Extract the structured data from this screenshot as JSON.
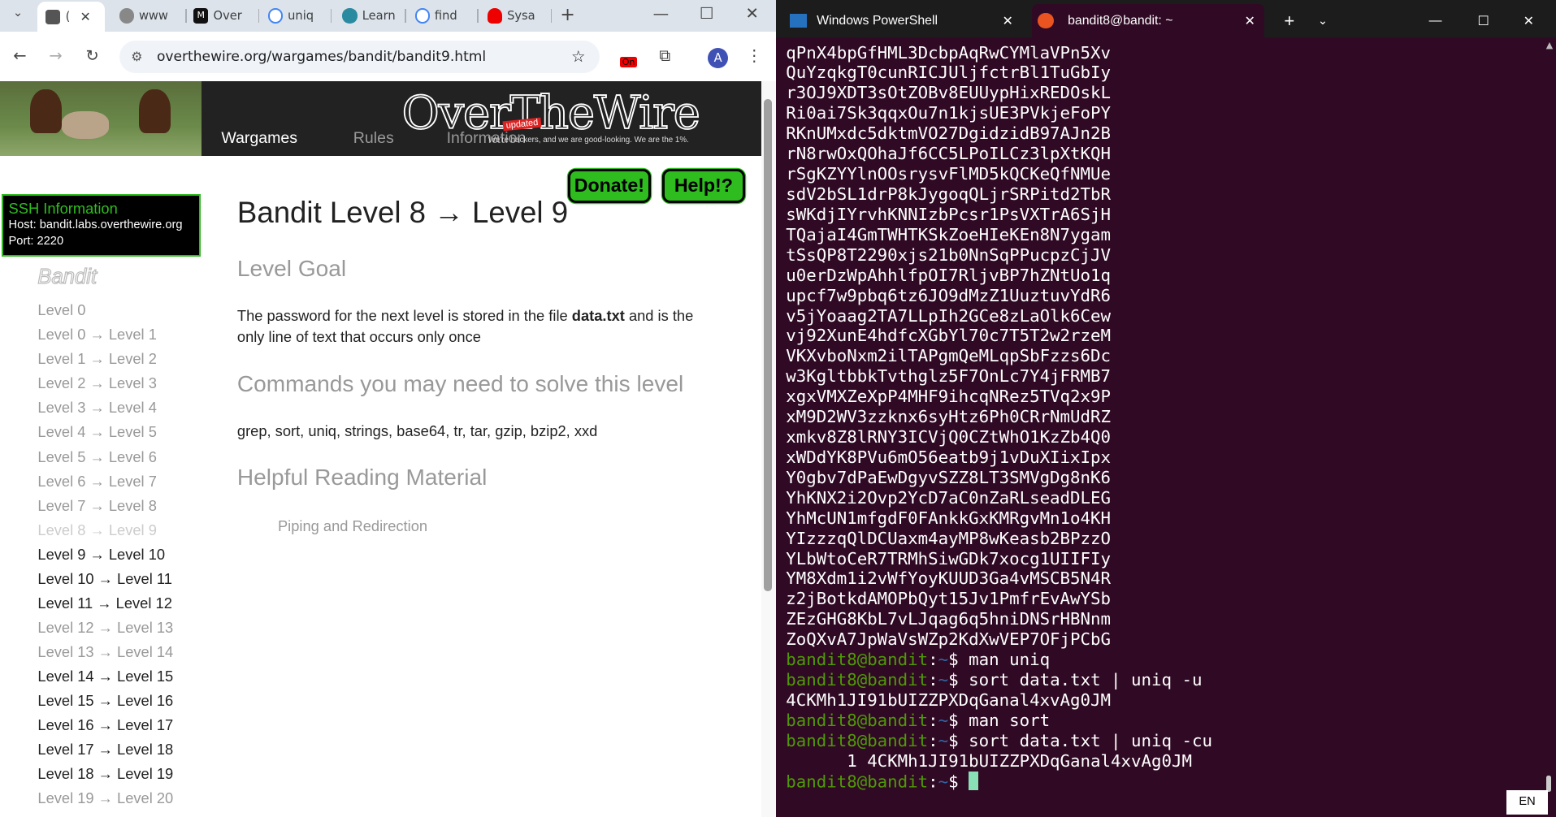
{
  "browser": {
    "tabs": [
      {
        "label": "(",
        "icon": "site-icon"
      },
      {
        "label": "www",
        "icon": "globe-icon"
      },
      {
        "label": "Over",
        "icon": "medium-icon"
      },
      {
        "label": "uniq",
        "icon": "google-icon"
      },
      {
        "label": "Learn",
        "icon": "learn-icon"
      },
      {
        "label": "find",
        "icon": "google-icon"
      },
      {
        "label": "Sysa",
        "icon": "redhat-icon"
      }
    ],
    "url": "overthewire.org/wargames/bandit/bandit9.html",
    "profile_initial": "A",
    "extension_badge": "On"
  },
  "page": {
    "logo_text": "OverTheWire",
    "slogan": "We're hackers, and we are good-looking. We are the 1%.",
    "updated_badge": "updated",
    "nav": [
      "Wargames",
      "Rules",
      "Information"
    ],
    "donate_label": "Donate!",
    "help_label": "Help!?",
    "ssh": {
      "title": "SSH Information",
      "host": "Host: bandit.labs.overthewire.org",
      "port": "Port: 2220"
    },
    "bandit_logo": "Bandit",
    "levels": [
      {
        "label": "Level 0",
        "visited": true
      },
      {
        "label": "Level 0 → Level 1",
        "visited": true
      },
      {
        "label": "Level 1 → Level 2",
        "visited": true
      },
      {
        "label": "Level 2 → Level 3",
        "visited": true
      },
      {
        "label": "Level 3 → Level 4",
        "visited": true
      },
      {
        "label": "Level 4 → Level 5",
        "visited": true
      },
      {
        "label": "Level 5 → Level 6",
        "visited": true
      },
      {
        "label": "Level 6 → Level 7",
        "visited": true
      },
      {
        "label": "Level 7 → Level 8",
        "visited": true
      },
      {
        "label": "Level 8 → Level 9",
        "current": true
      },
      {
        "label": "Level 9 → Level 10"
      },
      {
        "label": "Level 10 → Level 11"
      },
      {
        "label": "Level 11 → Level 12"
      },
      {
        "label": "Level 12 → Level 13",
        "visited": true
      },
      {
        "label": "Level 13 → Level 14",
        "visited": true
      },
      {
        "label": "Level 14 → Level 15"
      },
      {
        "label": "Level 15 → Level 16"
      },
      {
        "label": "Level 16 → Level 17"
      },
      {
        "label": "Level 17 → Level 18"
      },
      {
        "label": "Level 18 → Level 19"
      },
      {
        "label": "Level 19 → Level 20",
        "visited": true
      }
    ],
    "title": "Bandit Level 8 → Level 9",
    "goal_heading": "Level Goal",
    "goal_text_before": "The password for the next level is stored in the file ",
    "goal_file": "data.txt",
    "goal_text_after": " and is the only line of text that occurs only once",
    "commands_heading": "Commands you may need to solve this level",
    "commands": "grep, sort, uniq, strings, base64, tr, tar, gzip, bzip2, xxd",
    "reading_heading": "Helpful Reading Material",
    "reading_link": "Piping and Redirection"
  },
  "terminal": {
    "tabs": [
      "Windows PowerShell",
      "bandit8@bandit: ~"
    ],
    "output_lines": [
      "qPnX4bpGfHML3DcbpAqRwCYMlaVPn5Xv",
      "QuYzqkgT0cunRICJUljfctrBl1TuGbIy",
      "r3OJ9XDT3sOtZOBv8EUUypHixREDOskL",
      "Ri0ai7Sk3qqxOu7n1kjsUE3PVkjeFoPY",
      "RKnUMxdc5dktmVO27DgidzidB97AJn2B",
      "rN8rwOxQOhaJf6CC5LPoILCz3lpXtKQH",
      "rSgKZYYlnOOsrysvFlMD5kQCKeQfNMUe",
      "sdV2bSL1drP8kJygoqQLjrSRPitd2TbR",
      "sWKdjIYrvhKNNIzbPcsr1PsVXTrA6SjH",
      "TQajaI4GmTWHTKSkZoeHIeKEn8N7ygam",
      "tSsQP8T2290xjs21b0NnSqPPucpzCjJV",
      "u0erDzWpAhhlfpOI7RljvBP7hZNtUo1q",
      "upcf7w9pbq6tz6JO9dMzZ1UuztuvYdR6",
      "v5jYoaag2TA7LLpIh2GCe8zLaOlk6Cew",
      "vj92XunE4hdfcXGbYl70c7T5T2w2rzeM",
      "VKXvboNxm2ilTAPgmQeMLqpSbFzzs6Dc",
      "w3KgltbbkTvthglz5F7OnLc7Y4jFRMB7",
      "xgxVMXZeXpP4MHF9ihcqNRez5TVq2x9P",
      "xM9D2WV3zzknx6syHtz6Ph0CRrNmUdRZ",
      "xmkv8Z8lRNY3ICVjQ0CZtWhO1KzZb4Q0",
      "xWDdYK8PVu6mO56eatb9j1vDuXIixIpx",
      "Y0gbv7dPaEwDgyvSZZ8LT3SMVgDg8nK6",
      "YhKNX2i2Ovp2YcD7aC0nZaRLseadDLEG",
      "YhMcUN1mfgdF0FAnkkGxKMRgvMn1o4KH",
      "YIzzzqQlDCUaxm4ayMP8wKeasb2BPzzO",
      "YLbWtoCeR7TRMhSiwGDk7xocg1UIIFIy",
      "YM8Xdm1i2vWfYoyKUUD3Ga4vMSCB5N4R",
      "z2jBotkdAMOPbQyt15Jv1PmfrEvAwYSb",
      "ZEzGHG8KbL7vLJqag6q5hniDNSrHBNnm",
      "ZoQXvA7JpWaVsWZp2KdXwVEP7OFjPCbG"
    ],
    "prompt_user": "bandit8@bandit",
    "prompt_path": "~",
    "prompt_sep": ":",
    "prompt_end": "$ ",
    "session": [
      {
        "cmd": "man uniq"
      },
      {
        "cmd": "sort data.txt | uniq -u",
        "out": "4CKMh1JI91bUIZZPXDqGanal4xvAg0JM"
      },
      {
        "cmd": "man sort"
      },
      {
        "cmd": "sort data.txt | uniq -cu",
        "out": "      1 4CKMh1JI91bUIZZPXDqGanal4xvAg0JM"
      },
      {
        "cmd": ""
      }
    ]
  },
  "taskbar": {
    "language": "EN"
  },
  "colors": {
    "accent_green": "#2ebc1f",
    "terminal_bg": "#300a24",
    "prompt_green": "#4e9a06",
    "prompt_blue": "#3465a4"
  }
}
